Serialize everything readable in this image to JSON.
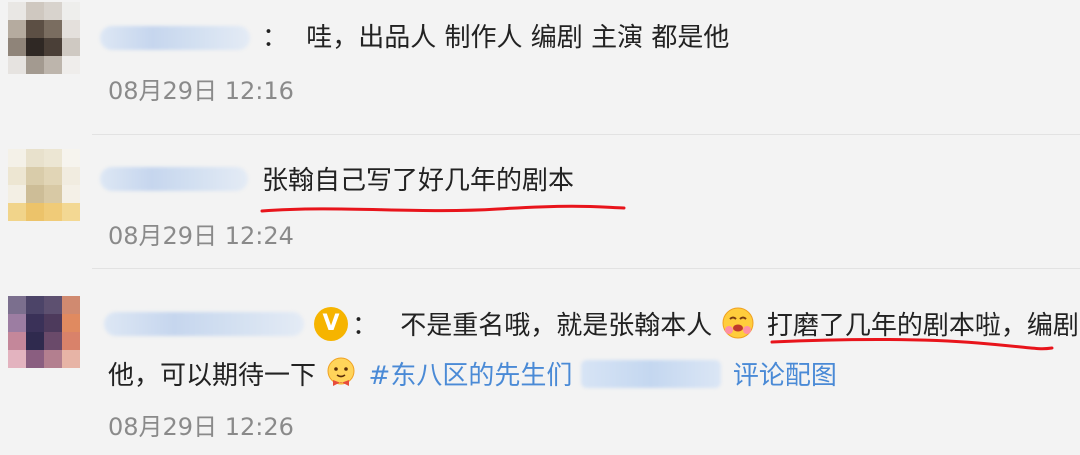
{
  "comments": [
    {
      "separator": "：",
      "text": "哇，出品人 制作人 编剧 主演 都是他",
      "time": "08月29日 12:16"
    },
    {
      "text": "张翰自己写了好几年的剧本",
      "time": "08月29日 12:24"
    },
    {
      "verified_badge": "V",
      "separator": "：",
      "text_part1": "不是重名哦，就是张翰本人",
      "text_part2": "打磨了几年的剧本啦，编剧",
      "text_line2": "他，可以期待一下",
      "hashtag": "#东八区的先生们",
      "link_text": "评论配图",
      "time": "08月29日 12:26"
    }
  ],
  "colors": {
    "background": "#f3f3f3",
    "text": "#222222",
    "time": "#8a8a8a",
    "link": "#4a8ad6",
    "underline": "#e8141b",
    "verified": "#f6b400"
  },
  "icons": [
    "verified-icon",
    "hugging-face-emoji",
    "bow-face-emoji"
  ]
}
